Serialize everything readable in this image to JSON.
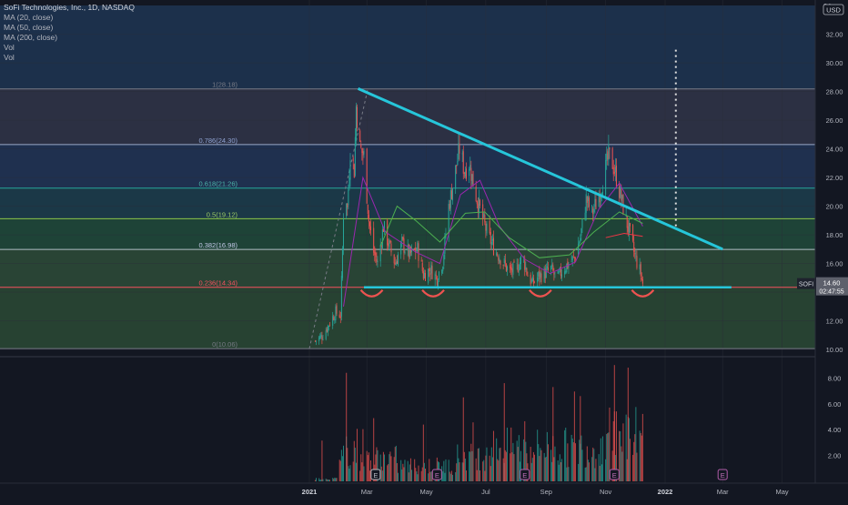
{
  "chart_data": {
    "type": "candlestick",
    "symbol": "SOFI",
    "title": "SoFi Technologies, Inc., 1D, NASDAQ",
    "indicators": [
      "MA (20, close)",
      "MA (50, close)",
      "MA (200, close)",
      "Vol",
      "Vol"
    ],
    "currency": "USD",
    "price_axis": {
      "ticks": [
        "32.00",
        "30.00",
        "28.00",
        "26.00",
        "24.00",
        "22.00",
        "20.00",
        "18.00",
        "16.00",
        "14.00",
        "12.00",
        "10.00"
      ],
      "ylim": [
        9.5,
        34
      ]
    },
    "volume_axis": {
      "ticks": [
        "8.00",
        "6.00",
        "4.00",
        "2.00"
      ],
      "ylim": [
        0,
        10
      ]
    },
    "time_axis": [
      "2021",
      "Mar",
      "May",
      "Jul",
      "Sep",
      "Nov",
      "2022",
      "Mar",
      "May"
    ],
    "current_price": {
      "symbol": "SOFI",
      "price": "14.60",
      "countdown": "02:47:55"
    },
    "fib_levels": [
      {
        "label": "1(28.18)",
        "ratio": 1,
        "price": 28.18
      },
      {
        "label": "0.786(24.30)",
        "ratio": 0.786,
        "price": 24.3
      },
      {
        "label": "0.618(21.26)",
        "ratio": 0.618,
        "price": 21.26
      },
      {
        "label": "0.5(19.12)",
        "ratio": 0.5,
        "price": 19.12
      },
      {
        "label": "0.382(16.98)",
        "ratio": 0.382,
        "price": 16.98
      },
      {
        "label": "0.236(14.34)",
        "ratio": 0.236,
        "price": 14.34
      },
      {
        "label": "0(10.06)",
        "ratio": 0,
        "price": 10.06
      }
    ],
    "price_path": [
      [
        "2021-01-07",
        10.6
      ],
      [
        "2021-01-15",
        11.0
      ],
      [
        "2021-01-22",
        11.9
      ],
      [
        "2021-01-28",
        12.6
      ],
      [
        "2021-02-02",
        12.4
      ],
      [
        "2021-02-04",
        17.0
      ],
      [
        "2021-02-06",
        22.0
      ],
      [
        "2021-02-09",
        19.8
      ],
      [
        "2021-02-12",
        24.0
      ],
      [
        "2021-02-16",
        22.5
      ],
      [
        "2021-02-18",
        27.0
      ],
      [
        "2021-02-22",
        24.0
      ],
      [
        "2021-02-26",
        23.5
      ],
      [
        "2021-03-03",
        19.0
      ],
      [
        "2021-03-08",
        16.8
      ],
      [
        "2021-03-12",
        16.0
      ],
      [
        "2021-03-18",
        18.6
      ],
      [
        "2021-03-24",
        17.2
      ],
      [
        "2021-03-30",
        16.0
      ],
      [
        "2021-04-06",
        17.4
      ],
      [
        "2021-04-14",
        16.6
      ],
      [
        "2021-04-22",
        17.0
      ],
      [
        "2021-04-28",
        15.2
      ],
      [
        "2021-05-05",
        15.6
      ],
      [
        "2021-05-12",
        15.0
      ],
      [
        "2021-05-18",
        16.2
      ],
      [
        "2021-05-24",
        20.0
      ],
      [
        "2021-05-31",
        22.5
      ],
      [
        "2021-06-04",
        24.0
      ],
      [
        "2021-06-09",
        22.5
      ],
      [
        "2021-06-14",
        23.0
      ],
      [
        "2021-06-20",
        21.0
      ],
      [
        "2021-06-26",
        19.5
      ],
      [
        "2021-07-03",
        18.0
      ],
      [
        "2021-07-10",
        17.0
      ],
      [
        "2021-07-18",
        16.2
      ],
      [
        "2021-07-25",
        15.4
      ],
      [
        "2021-08-01",
        15.6
      ],
      [
        "2021-08-08",
        16.5
      ],
      [
        "2021-08-13",
        15.2
      ],
      [
        "2021-08-18",
        14.6
      ],
      [
        "2021-08-24",
        15.1
      ],
      [
        "2021-08-30",
        15.3
      ],
      [
        "2021-09-06",
        15.6
      ],
      [
        "2021-09-12",
        14.9
      ],
      [
        "2021-09-18",
        15.6
      ],
      [
        "2021-09-24",
        16.0
      ],
      [
        "2021-09-30",
        16.4
      ],
      [
        "2021-10-06",
        17.8
      ],
      [
        "2021-10-12",
        20.5
      ],
      [
        "2021-10-18",
        19.5
      ],
      [
        "2021-10-24",
        20.5
      ],
      [
        "2021-10-30",
        22.0
      ],
      [
        "2021-11-04",
        23.5
      ],
      [
        "2021-11-08",
        23.0
      ],
      [
        "2021-11-12",
        22.0
      ],
      [
        "2021-11-17",
        20.5
      ],
      [
        "2021-11-22",
        19.0
      ],
      [
        "2021-11-26",
        18.0
      ],
      [
        "2021-12-01",
        16.5
      ],
      [
        "2021-12-06",
        15.5
      ],
      [
        "2021-12-09",
        14.6
      ]
    ],
    "moving_averages": [
      {
        "name": "MA (20, close)",
        "color": "#9c27b0",
        "points": [
          [
            "2021-02-05",
            13.0
          ],
          [
            "2021-02-25",
            22.0
          ],
          [
            "2021-03-20",
            18.2
          ],
          [
            "2021-04-20",
            16.8
          ],
          [
            "2021-05-15",
            16.0
          ],
          [
            "2021-06-05",
            20.8
          ],
          [
            "2021-06-25",
            21.8
          ],
          [
            "2021-07-15",
            18.6
          ],
          [
            "2021-08-10",
            16.3
          ],
          [
            "2021-09-05",
            15.3
          ],
          [
            "2021-10-01",
            16.1
          ],
          [
            "2021-10-25",
            19.8
          ],
          [
            "2021-11-15",
            21.6
          ],
          [
            "2021-12-09",
            18.6
          ]
        ]
      },
      {
        "name": "MA (50, close)",
        "color": "#4caf50",
        "points": [
          [
            "2021-03-15",
            17.2
          ],
          [
            "2021-04-01",
            20.0
          ],
          [
            "2021-04-20",
            19.0
          ],
          [
            "2021-05-15",
            17.5
          ],
          [
            "2021-06-10",
            19.5
          ],
          [
            "2021-06-30",
            19.6
          ],
          [
            "2021-07-25",
            17.8
          ],
          [
            "2021-08-25",
            16.4
          ],
          [
            "2021-09-25",
            16.6
          ],
          [
            "2021-10-20",
            18.2
          ],
          [
            "2021-11-15",
            19.6
          ],
          [
            "2021-12-09",
            18.8
          ]
        ]
      },
      {
        "name": "MA (200, close)",
        "color": "#f23645",
        "points": [
          [
            "2021-11-01",
            17.8
          ],
          [
            "2021-11-20",
            18.1
          ],
          [
            "2021-12-09",
            17.9
          ]
        ]
      }
    ],
    "drawings": {
      "descending_trendline": {
        "from": [
          "2021-02-20",
          28.2
        ],
        "to": [
          "2022-03-01",
          17.0
        ],
        "color": "#26c6da"
      },
      "support_line": {
        "from": [
          "2021-02-26",
          14.34
        ],
        "to": [
          "2022-03-10",
          14.34
        ],
        "color": "#26c6da"
      },
      "rise_dashed_line": {
        "from": [
          "2021-01-01",
          10.06
        ],
        "to": [
          "2021-02-16",
          28.18
        ]
      },
      "support_arcs": [
        "2021-03-06",
        "2021-05-08",
        "2021-08-26",
        "2021-12-09"
      ],
      "target_dotted_line": {
        "x": "2022-01-12",
        "from": 18.6,
        "to": 31.0
      }
    },
    "earnings_markers": [
      {
        "date": "2021-03-10",
        "label": ""
      },
      {
        "date": "2021-05-12",
        "label": "E"
      },
      {
        "date": "2021-08-10",
        "label": "E"
      },
      {
        "date": "2021-11-10",
        "label": "E"
      },
      {
        "date": "2022-03-01",
        "label": "E"
      }
    ],
    "volume_profile_note": "",
    "colors": {
      "up": "#26a69a",
      "down": "#ef5350",
      "background": "#131722",
      "axis_text": "#b2b5be"
    }
  }
}
